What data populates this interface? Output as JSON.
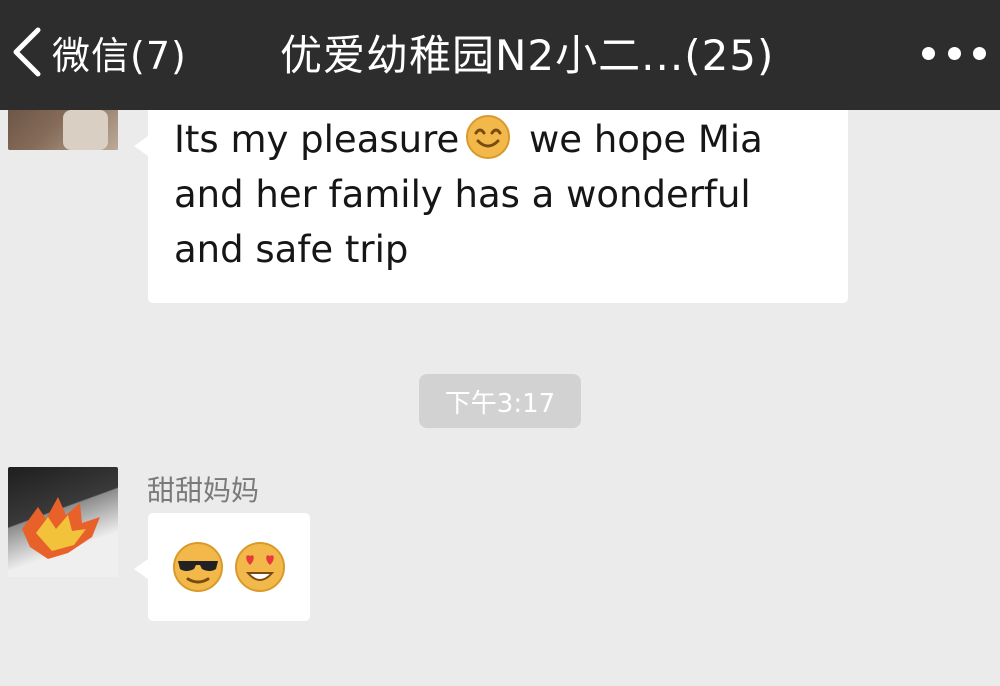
{
  "header": {
    "back_label": "微信(7)",
    "title": "优爱幼稚园N2小二...(25)",
    "icons": {
      "back": "chevron-left-icon",
      "more": "more-icon"
    }
  },
  "messages": [
    {
      "text_before_emoji": "Its my pleasure",
      "emoji": "smile-emoji",
      "text_after_emoji": "we hope Mia and her family has a wonderful and safe trip"
    },
    {
      "sender": "甜甜妈妈",
      "emojis": [
        "sunglasses-emoji",
        "heart-eyes-emoji"
      ]
    }
  ],
  "timestamp": "下午3:17",
  "colors": {
    "header_bg": "#2d2d2d",
    "chat_bg": "#ebebeb",
    "bubble_bg": "#ffffff",
    "timestamp_bg": "#d2d2d2"
  }
}
